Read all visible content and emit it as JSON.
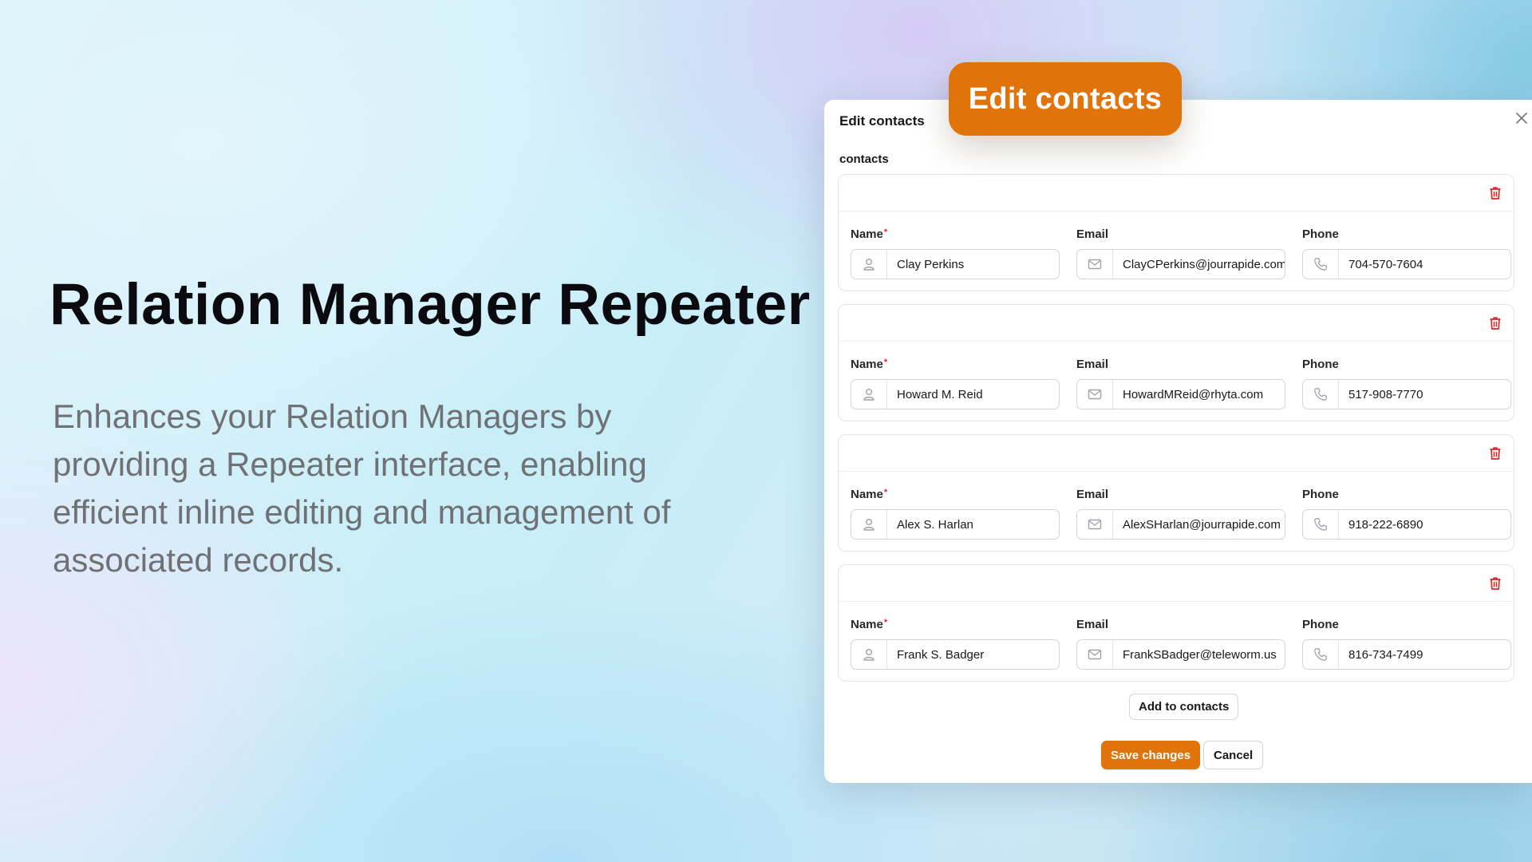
{
  "hero": {
    "title": "Relation Manager Repeater",
    "description": "Enhances your Relation Managers by providing a Repeater interface, enabling efficient inline editing and management of associated records."
  },
  "callout": {
    "label": "Edit contacts"
  },
  "modal": {
    "heading": "Edit contacts",
    "repeater_label": "contacts",
    "field_labels": {
      "name": "Name",
      "email": "Email",
      "phone": "Phone"
    },
    "contacts": [
      {
        "name": "Clay Perkins",
        "email": "ClayCPerkins@jourrapide.com",
        "phone": "704-570-7604"
      },
      {
        "name": "Howard M. Reid",
        "email": "HowardMReid@rhyta.com",
        "phone": "517-908-7770"
      },
      {
        "name": "Alex S. Harlan",
        "email": "AlexSHarlan@jourrapide.com",
        "phone": "918-222-6890"
      },
      {
        "name": "Frank S. Badger",
        "email": "FrankSBadger@teleworm.us",
        "phone": "816-734-7499"
      }
    ],
    "add_label": "Add to contacts",
    "save_label": "Save changes",
    "cancel_label": "Cancel"
  },
  "icons": {
    "name": "user-icon",
    "email": "envelope-icon",
    "phone": "phone-icon",
    "delete": "trash-icon",
    "close": "close-icon"
  },
  "colors": {
    "accent": "#e07309",
    "danger": "#dc2626"
  }
}
